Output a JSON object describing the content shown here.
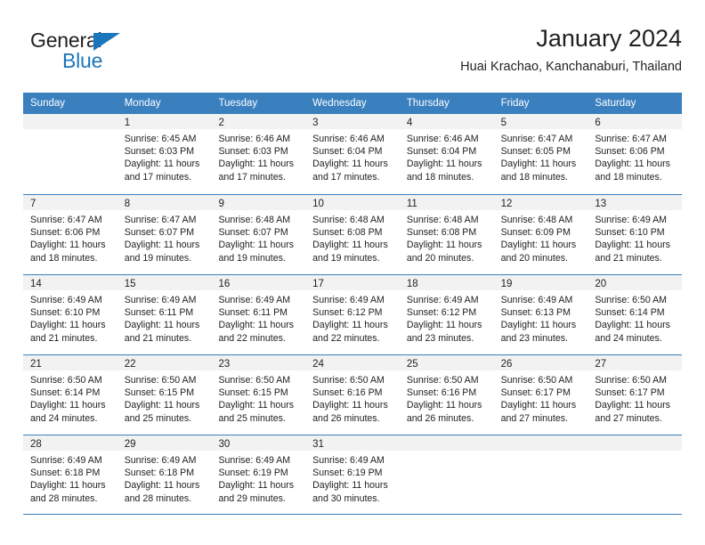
{
  "logo": {
    "word_one": "General",
    "word_two": "Blue",
    "triangle_color": "#1b76bc"
  },
  "header": {
    "title": "January 2024",
    "subtitle": "Huai Krachao, Kanchanaburi, Thailand"
  },
  "theme": {
    "header_blue": "#3a80bf",
    "band_gray": "#f2f2f2",
    "text": "#222222"
  },
  "weekdays": [
    "Sunday",
    "Monday",
    "Tuesday",
    "Wednesday",
    "Thursday",
    "Friday",
    "Saturday"
  ],
  "weeks": [
    [
      {
        "day": "",
        "lines": []
      },
      {
        "day": "1",
        "lines": [
          "Sunrise: 6:45 AM",
          "Sunset: 6:03 PM",
          "Daylight: 11 hours",
          "and 17 minutes."
        ]
      },
      {
        "day": "2",
        "lines": [
          "Sunrise: 6:46 AM",
          "Sunset: 6:03 PM",
          "Daylight: 11 hours",
          "and 17 minutes."
        ]
      },
      {
        "day": "3",
        "lines": [
          "Sunrise: 6:46 AM",
          "Sunset: 6:04 PM",
          "Daylight: 11 hours",
          "and 17 minutes."
        ]
      },
      {
        "day": "4",
        "lines": [
          "Sunrise: 6:46 AM",
          "Sunset: 6:04 PM",
          "Daylight: 11 hours",
          "and 18 minutes."
        ]
      },
      {
        "day": "5",
        "lines": [
          "Sunrise: 6:47 AM",
          "Sunset: 6:05 PM",
          "Daylight: 11 hours",
          "and 18 minutes."
        ]
      },
      {
        "day": "6",
        "lines": [
          "Sunrise: 6:47 AM",
          "Sunset: 6:06 PM",
          "Daylight: 11 hours",
          "and 18 minutes."
        ]
      }
    ],
    [
      {
        "day": "7",
        "lines": [
          "Sunrise: 6:47 AM",
          "Sunset: 6:06 PM",
          "Daylight: 11 hours",
          "and 18 minutes."
        ]
      },
      {
        "day": "8",
        "lines": [
          "Sunrise: 6:47 AM",
          "Sunset: 6:07 PM",
          "Daylight: 11 hours",
          "and 19 minutes."
        ]
      },
      {
        "day": "9",
        "lines": [
          "Sunrise: 6:48 AM",
          "Sunset: 6:07 PM",
          "Daylight: 11 hours",
          "and 19 minutes."
        ]
      },
      {
        "day": "10",
        "lines": [
          "Sunrise: 6:48 AM",
          "Sunset: 6:08 PM",
          "Daylight: 11 hours",
          "and 19 minutes."
        ]
      },
      {
        "day": "11",
        "lines": [
          "Sunrise: 6:48 AM",
          "Sunset: 6:08 PM",
          "Daylight: 11 hours",
          "and 20 minutes."
        ]
      },
      {
        "day": "12",
        "lines": [
          "Sunrise: 6:48 AM",
          "Sunset: 6:09 PM",
          "Daylight: 11 hours",
          "and 20 minutes."
        ]
      },
      {
        "day": "13",
        "lines": [
          "Sunrise: 6:49 AM",
          "Sunset: 6:10 PM",
          "Daylight: 11 hours",
          "and 21 minutes."
        ]
      }
    ],
    [
      {
        "day": "14",
        "lines": [
          "Sunrise: 6:49 AM",
          "Sunset: 6:10 PM",
          "Daylight: 11 hours",
          "and 21 minutes."
        ]
      },
      {
        "day": "15",
        "lines": [
          "Sunrise: 6:49 AM",
          "Sunset: 6:11 PM",
          "Daylight: 11 hours",
          "and 21 minutes."
        ]
      },
      {
        "day": "16",
        "lines": [
          "Sunrise: 6:49 AM",
          "Sunset: 6:11 PM",
          "Daylight: 11 hours",
          "and 22 minutes."
        ]
      },
      {
        "day": "17",
        "lines": [
          "Sunrise: 6:49 AM",
          "Sunset: 6:12 PM",
          "Daylight: 11 hours",
          "and 22 minutes."
        ]
      },
      {
        "day": "18",
        "lines": [
          "Sunrise: 6:49 AM",
          "Sunset: 6:12 PM",
          "Daylight: 11 hours",
          "and 23 minutes."
        ]
      },
      {
        "day": "19",
        "lines": [
          "Sunrise: 6:49 AM",
          "Sunset: 6:13 PM",
          "Daylight: 11 hours",
          "and 23 minutes."
        ]
      },
      {
        "day": "20",
        "lines": [
          "Sunrise: 6:50 AM",
          "Sunset: 6:14 PM",
          "Daylight: 11 hours",
          "and 24 minutes."
        ]
      }
    ],
    [
      {
        "day": "21",
        "lines": [
          "Sunrise: 6:50 AM",
          "Sunset: 6:14 PM",
          "Daylight: 11 hours",
          "and 24 minutes."
        ]
      },
      {
        "day": "22",
        "lines": [
          "Sunrise: 6:50 AM",
          "Sunset: 6:15 PM",
          "Daylight: 11 hours",
          "and 25 minutes."
        ]
      },
      {
        "day": "23",
        "lines": [
          "Sunrise: 6:50 AM",
          "Sunset: 6:15 PM",
          "Daylight: 11 hours",
          "and 25 minutes."
        ]
      },
      {
        "day": "24",
        "lines": [
          "Sunrise: 6:50 AM",
          "Sunset: 6:16 PM",
          "Daylight: 11 hours",
          "and 26 minutes."
        ]
      },
      {
        "day": "25",
        "lines": [
          "Sunrise: 6:50 AM",
          "Sunset: 6:16 PM",
          "Daylight: 11 hours",
          "and 26 minutes."
        ]
      },
      {
        "day": "26",
        "lines": [
          "Sunrise: 6:50 AM",
          "Sunset: 6:17 PM",
          "Daylight: 11 hours",
          "and 27 minutes."
        ]
      },
      {
        "day": "27",
        "lines": [
          "Sunrise: 6:50 AM",
          "Sunset: 6:17 PM",
          "Daylight: 11 hours",
          "and 27 minutes."
        ]
      }
    ],
    [
      {
        "day": "28",
        "lines": [
          "Sunrise: 6:49 AM",
          "Sunset: 6:18 PM",
          "Daylight: 11 hours",
          "and 28 minutes."
        ]
      },
      {
        "day": "29",
        "lines": [
          "Sunrise: 6:49 AM",
          "Sunset: 6:18 PM",
          "Daylight: 11 hours",
          "and 28 minutes."
        ]
      },
      {
        "day": "30",
        "lines": [
          "Sunrise: 6:49 AM",
          "Sunset: 6:19 PM",
          "Daylight: 11 hours",
          "and 29 minutes."
        ]
      },
      {
        "day": "31",
        "lines": [
          "Sunrise: 6:49 AM",
          "Sunset: 6:19 PM",
          "Daylight: 11 hours",
          "and 30 minutes."
        ]
      },
      {
        "day": "",
        "lines": []
      },
      {
        "day": "",
        "lines": []
      },
      {
        "day": "",
        "lines": []
      }
    ]
  ]
}
